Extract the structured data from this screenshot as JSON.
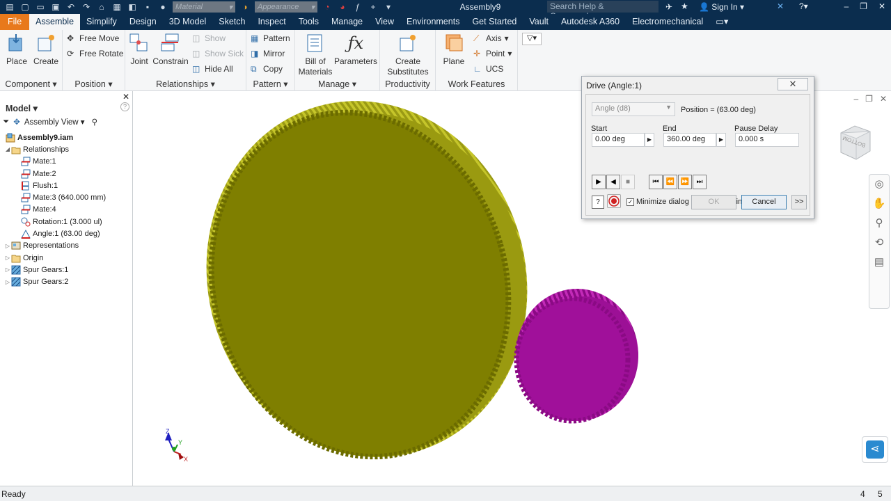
{
  "title_bar": {
    "material_placeholder": "Material",
    "appearance_placeholder": "Appearance",
    "document_title": "Assembly9",
    "search_placeholder": "Search Help & Commands...",
    "sign_in": "Sign In"
  },
  "tabs": [
    "File",
    "Assemble",
    "Simplify",
    "Design",
    "3D Model",
    "Sketch",
    "Inspect",
    "Tools",
    "Manage",
    "View",
    "Environments",
    "Get Started",
    "Vault",
    "Autodesk A360",
    "Electromechanical"
  ],
  "active_tab": "Assemble",
  "ribbon": {
    "component": {
      "label": "Component",
      "place": "Place",
      "create": "Create"
    },
    "position": {
      "label": "Position",
      "free_move": "Free Move",
      "free_rotate": "Free Rotate"
    },
    "relationships": {
      "label": "Relationships",
      "joint": "Joint",
      "constrain": "Constrain",
      "show": "Show",
      "show_sick": "Show Sick",
      "hide_all": "Hide All"
    },
    "pattern": {
      "label": "Pattern",
      "pattern": "Pattern",
      "mirror": "Mirror",
      "copy": "Copy"
    },
    "manage": {
      "label": "Manage",
      "bom": "Bill of\nMaterials",
      "parameters": "Parameters"
    },
    "productivity": {
      "label": "Productivity",
      "create_substitutes": "Create\nSubstitutes"
    },
    "work_features": {
      "label": "Work Features",
      "plane": "Plane",
      "axis": "Axis",
      "point": "Point",
      "ucs": "UCS"
    }
  },
  "browser": {
    "header": "Model",
    "view": "Assembly View",
    "tree": [
      {
        "label": "Assembly9.iam",
        "level": 0,
        "bold": true,
        "icon": "assembly-icon"
      },
      {
        "label": "Relationships",
        "level": 0,
        "expanded": true,
        "icon": "folder-open-icon"
      },
      {
        "label": "Mate:1",
        "level": 1,
        "icon": "mate-icon"
      },
      {
        "label": "Mate:2",
        "level": 1,
        "icon": "mate-icon"
      },
      {
        "label": "Flush:1",
        "level": 1,
        "icon": "flush-icon"
      },
      {
        "label": "Mate:3 (640.000 mm)",
        "level": 1,
        "icon": "mate-icon"
      },
      {
        "label": "Mate:4",
        "level": 1,
        "icon": "mate-icon"
      },
      {
        "label": "Rotation:1 (3.000 ul)",
        "level": 1,
        "icon": "rotation-icon"
      },
      {
        "label": "Angle:1 (63.00 deg)",
        "level": 1,
        "icon": "angle-icon"
      },
      {
        "label": "Representations",
        "level": 0,
        "collapsed": true,
        "icon": "representations-icon"
      },
      {
        "label": "Origin",
        "level": 0,
        "collapsed": true,
        "icon": "folder-icon"
      },
      {
        "label": "Spur Gears:1",
        "level": 0,
        "collapsed": true,
        "icon": "gear-part-icon"
      },
      {
        "label": "Spur Gears:2",
        "level": 0,
        "collapsed": true,
        "icon": "gear-part-icon"
      }
    ]
  },
  "dialog": {
    "title": "Drive (Angle:1)",
    "dimension": "Angle (d8)",
    "position": "Position = (63.00 deg)",
    "start_label": "Start",
    "start_value": "0.00 deg",
    "end_label": "End",
    "end_value": "360.00 deg",
    "pause_label": "Pause Delay",
    "pause_value": "0.000 s",
    "minimize_label": "Minimize dialog during recording",
    "minimize_checked": true,
    "ok": "OK",
    "cancel": "Cancel",
    "more": ">>"
  },
  "viewcube_label": "BOTTOM",
  "status": {
    "text": "Ready",
    "num1": "4",
    "num2": "5"
  },
  "colors": {
    "accent_file": "#e8791c",
    "title_bar": "#0b2d4e",
    "gear_large": "#808000",
    "gear_small": "#a0109a"
  }
}
